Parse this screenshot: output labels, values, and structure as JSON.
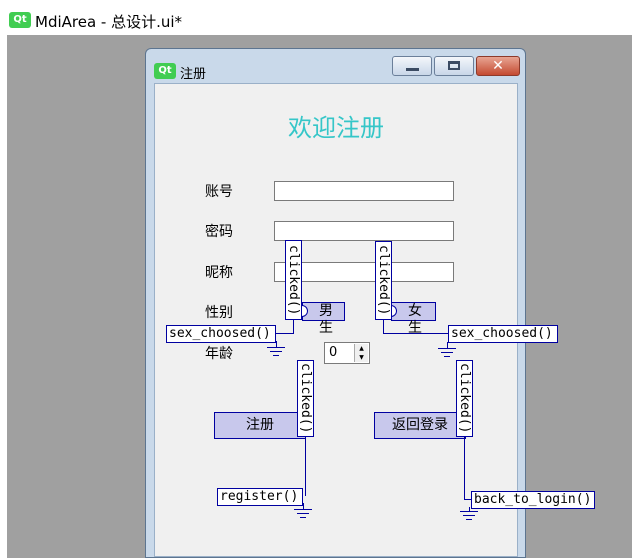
{
  "app": {
    "title": "MdiArea - 总设计.ui*",
    "logo": "Qt"
  },
  "subwindow": {
    "title": "注册",
    "logo": "Qt",
    "buttons": {
      "minimize": "minimize-icon",
      "maximize": "maximize-icon",
      "close": "✕"
    }
  },
  "form": {
    "headline": "欢迎注册",
    "account_label": "账号",
    "password_label": "密码",
    "nickname_label": "昵称",
    "gender_label": "性别",
    "male_label": "男生",
    "female_label": "女生",
    "age_label": "年龄",
    "age_value": "0",
    "register_button": "注册",
    "back_button": "返回登录"
  },
  "connections": {
    "male_signal": "clicked()",
    "male_slot": "sex_choosed()",
    "female_signal": "clicked()",
    "female_slot": "sex_choosed()",
    "register_signal": "clicked()",
    "register_slot": "register()",
    "back_signal": "clicked()",
    "back_slot": "back_to_login()"
  },
  "colors": {
    "headline": "#35c6c8",
    "connection": "#0000a0",
    "widget_highlight": "#c8c8ec",
    "mdi_background": "#a0a0a0"
  }
}
